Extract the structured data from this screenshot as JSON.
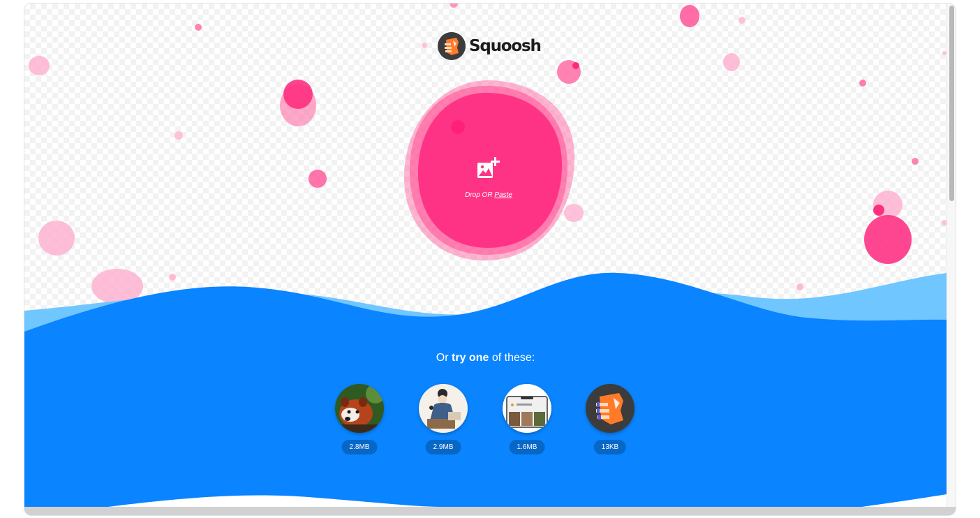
{
  "app": {
    "name": "Squoosh"
  },
  "drop_zone": {
    "drop_label": "Drop OR",
    "paste_label": "Paste",
    "icon": "add-image-icon"
  },
  "demos": {
    "heading_prefix": "Or",
    "heading_bold": "try one",
    "heading_suffix": "of these:",
    "items": [
      {
        "name": "red-panda",
        "size": "2.8MB"
      },
      {
        "name": "artwork",
        "size": "2.9MB"
      },
      {
        "name": "device-screen",
        "size": "1.6MB"
      },
      {
        "name": "squoosh-logo",
        "size": "13KB"
      }
    ]
  },
  "colors": {
    "pink": "#ff3385",
    "light_pink": "#ffb3d1",
    "blue": "#0a84ff",
    "light_blue": "#70c6ff"
  }
}
